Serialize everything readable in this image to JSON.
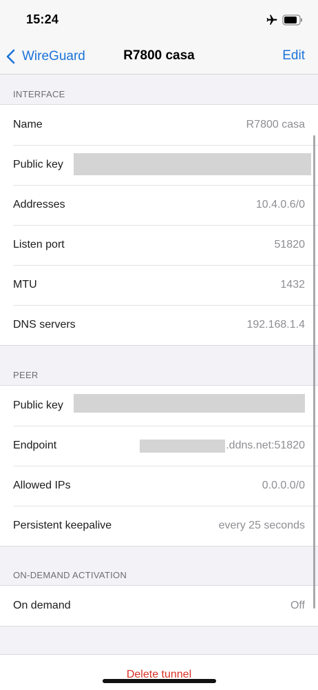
{
  "status_bar": {
    "time": "15:24"
  },
  "nav": {
    "back_label": "WireGuard",
    "title": "R7800 casa",
    "edit_label": "Edit"
  },
  "interface": {
    "header": "INTERFACE",
    "rows": [
      {
        "label": "Name",
        "value": "R7800 casa"
      },
      {
        "label": "Public key",
        "value": ""
      },
      {
        "label": "Addresses",
        "value": "10.4.0.6/0"
      },
      {
        "label": "Listen port",
        "value": "51820"
      },
      {
        "label": "MTU",
        "value": "1432"
      },
      {
        "label": "DNS servers",
        "value": "192.168.1.4"
      }
    ]
  },
  "peer": {
    "header": "PEER",
    "rows": [
      {
        "label": "Public key",
        "value": ""
      },
      {
        "label": "Endpoint",
        "value": ".ddns.net:51820"
      },
      {
        "label": "Allowed IPs",
        "value": "0.0.0.0/0"
      },
      {
        "label": "Persistent keepalive",
        "value": "every 25 seconds"
      }
    ]
  },
  "on_demand": {
    "header": "ON-DEMAND ACTIVATION",
    "rows": [
      {
        "label": "On demand",
        "value": "Off"
      }
    ]
  },
  "delete_label": "Delete tunnel",
  "colors": {
    "accent": "#1a73d9",
    "destructive": "#d93025",
    "background": "#f2f2f7"
  },
  "icons": {
    "back": "chevron-left-icon",
    "airplane": "airplane-icon",
    "battery": "battery-icon"
  }
}
